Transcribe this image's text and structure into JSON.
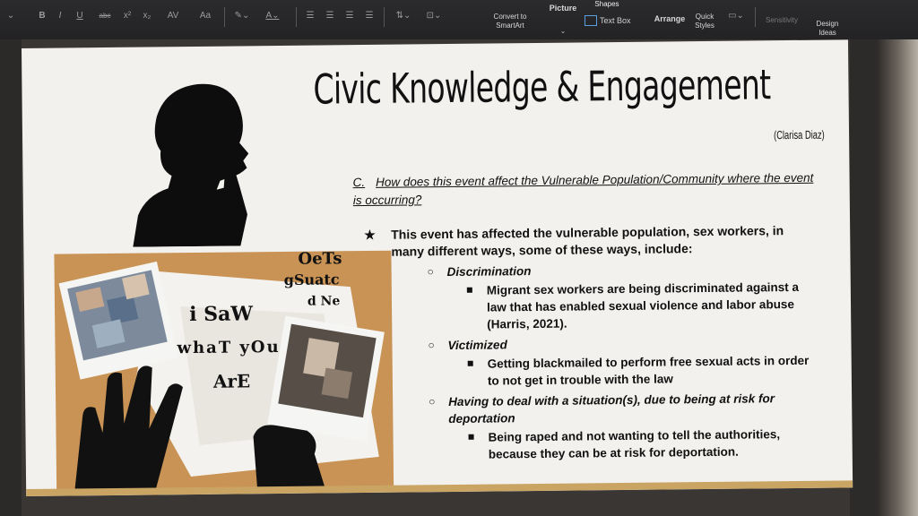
{
  "ribbon": {
    "bold": "B",
    "italic": "I",
    "underline": "U",
    "strike": "abc",
    "superscript": "x²",
    "subscript": "x₂",
    "spacing": "AV",
    "case": "Aa",
    "convert_smartart": "Convert to SmartArt",
    "picture": "Picture",
    "text_box": "Text Box",
    "arrange": "Arrange",
    "quick_styles": "Quick Styles",
    "sensitivity": "Sensitivity",
    "design_ideas": "Design Ideas",
    "shapes": "Shapes"
  },
  "slide": {
    "title": "Civic Knowledge & Engagement",
    "author": "(Clarisa Diaz)",
    "question_letter": "C.",
    "question": "How does this event affect the Vulnerable Population/Community where the event is occurring?",
    "main_bullet": "This event has affected the vulnerable population, sex workers, in many different ways, some of these ways, include:",
    "items": [
      {
        "heading": "Discrimination",
        "detail": "Migrant sex workers are being discriminated against a law that has enabled sexual violence and labor abuse (Harris, 2021)."
      },
      {
        "heading": "Victimized",
        "detail": "Getting blackmailed to perform free sexual acts in order to not get in trouble with the law"
      },
      {
        "heading": "Having to deal with a situation(s), due to being at risk for deportation",
        "detail": "Being raped and not wanting to tell the authorities, because they can be at risk for deportation."
      }
    ]
  },
  "collage": {
    "cutout_1": "i SaW",
    "cutout_2": "whaT yOu",
    "cutout_3": "ArE",
    "cutout_4": "OeTs",
    "cutout_5": "gSuatc",
    "cutout_6": "d Ne"
  },
  "colors": {
    "ribbon_bg": "#2b2b2d",
    "slide_bg": "#f2f1ee",
    "accent_bar": "#c9a463",
    "collage_bg": "#c99355"
  }
}
